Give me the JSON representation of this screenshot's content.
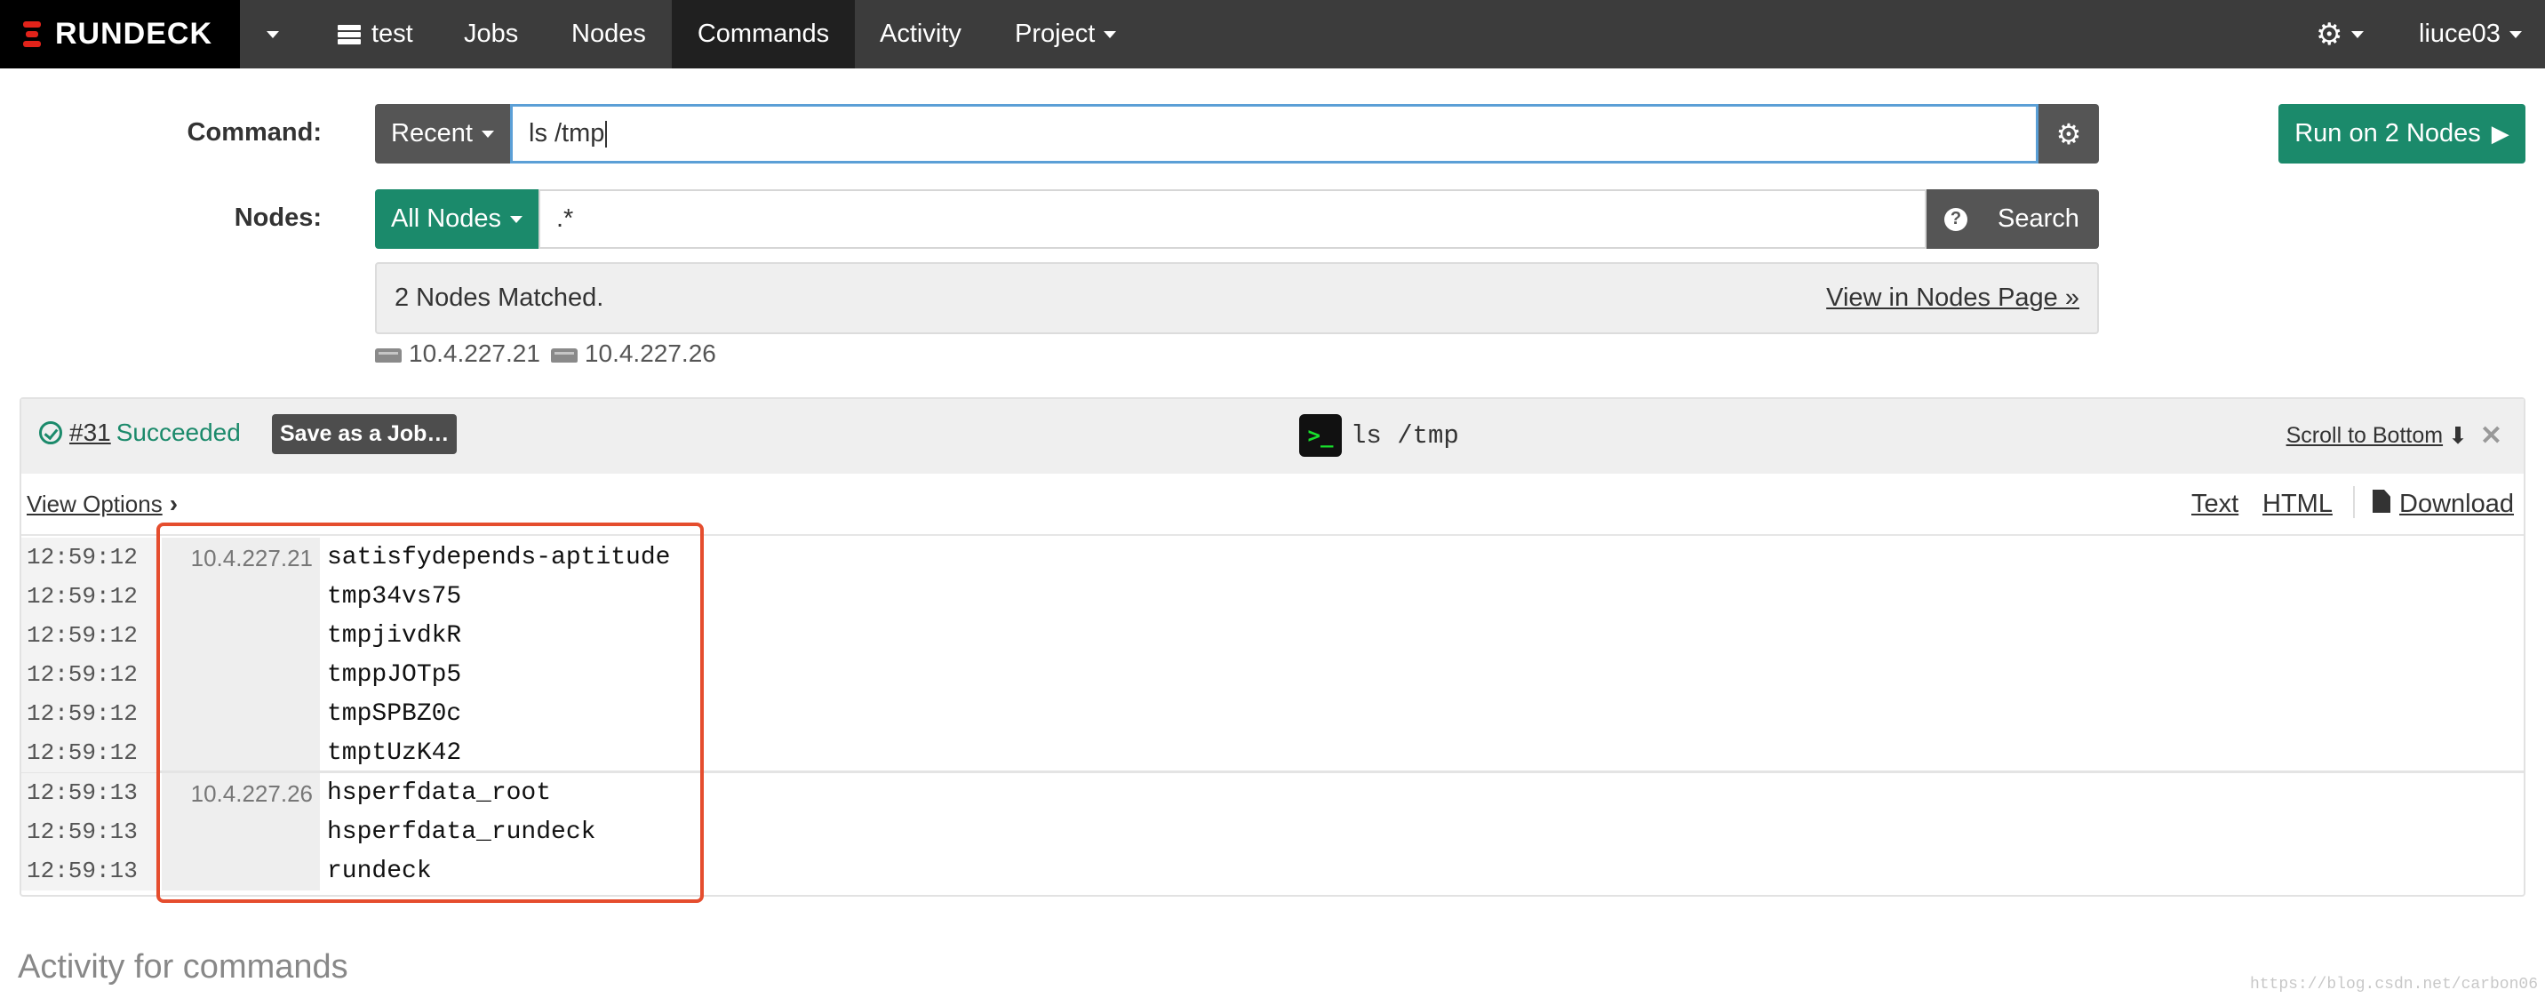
{
  "brand": {
    "name": "RUNDECK",
    "accent": "#e2231a"
  },
  "nav": {
    "project": "test",
    "items": [
      {
        "label": "Jobs"
      },
      {
        "label": "Nodes"
      },
      {
        "label": "Commands",
        "active": true
      },
      {
        "label": "Activity"
      },
      {
        "label": "Project"
      }
    ],
    "settings_icon": "gear-icon",
    "user": "liuce03"
  },
  "command_form": {
    "command_label": "Command:",
    "recent_label": "Recent",
    "command_value": "ls /tmp",
    "run_button": "Run on 2 Nodes",
    "nodes_label": "Nodes:",
    "all_nodes_label": "All Nodes",
    "node_filter_value": ".*",
    "search_button": "Search",
    "matched_text": "2 Nodes Matched.",
    "view_nodes_link": "View in Nodes Page »",
    "matched_nodes": [
      "10.4.227.21",
      "10.4.227.26"
    ]
  },
  "execution": {
    "number": "#31",
    "status": "Succeeded",
    "save_job_label": "Save as a Job…",
    "command": "ls /tmp",
    "scroll_to_bottom": "Scroll to Bottom",
    "view_options": "View Options",
    "formats": {
      "text": "Text",
      "html": "HTML",
      "download": "Download"
    },
    "log": [
      {
        "time": "12:59:12",
        "node": "10.4.227.21",
        "output": "satisfydepends-aptitude"
      },
      {
        "time": "12:59:12",
        "node": "",
        "output": "tmp34vs75"
      },
      {
        "time": "12:59:12",
        "node": "",
        "output": "tmpjivdkR"
      },
      {
        "time": "12:59:12",
        "node": "",
        "output": "tmppJOTp5"
      },
      {
        "time": "12:59:12",
        "node": "",
        "output": "tmpSPBZ0c"
      },
      {
        "time": "12:59:12",
        "node": "",
        "output": "tmptUzK42"
      },
      {
        "time": "12:59:13",
        "node": "10.4.227.26",
        "output": "hsperfdata_root"
      },
      {
        "time": "12:59:13",
        "node": "",
        "output": "hsperfdata_rundeck"
      },
      {
        "time": "12:59:13",
        "node": "",
        "output": "rundeck"
      }
    ]
  },
  "activity_title": "Activity for commands",
  "watermark": "https://blog.csdn.net/carbon06",
  "colors": {
    "success": "#1b8a6b",
    "navbar": "#3c3c3c",
    "highlight": "#e54d2e"
  }
}
